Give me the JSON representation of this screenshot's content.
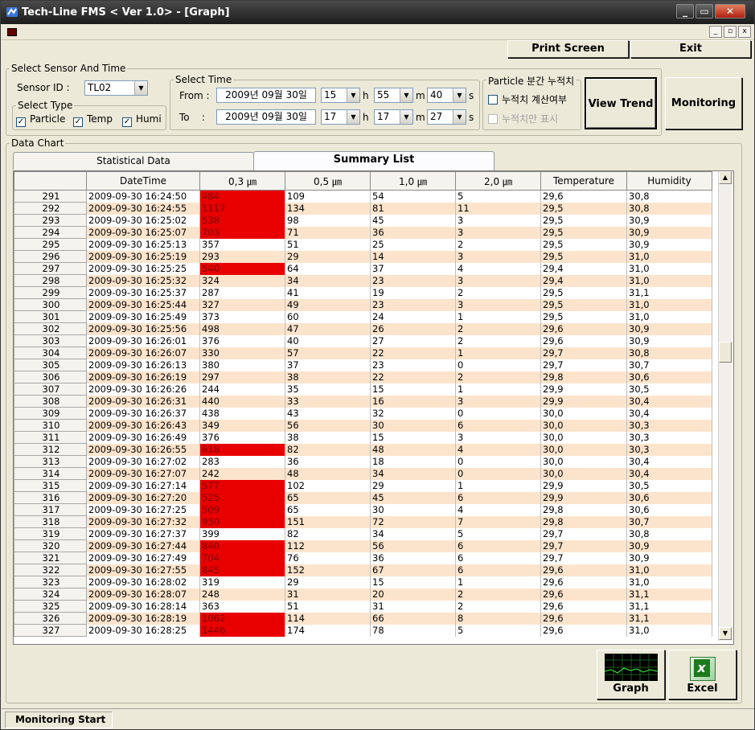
{
  "window": {
    "title": "Tech-Line FMS < Ver 1.0> - [Graph]",
    "min": "_",
    "max": "▭",
    "close": "✕"
  },
  "mdi": {
    "min": "_",
    "restore": "▫",
    "close": "x"
  },
  "toolbar": {
    "print_label": "Print Screen",
    "exit_label": "Exit"
  },
  "sensor_group": {
    "title": "Select Sensor And Time",
    "sensor_id_label": "Sensor ID :",
    "sensor_id_value": "TL02",
    "type_title": "Select Type",
    "types": [
      {
        "label": "Particle",
        "checked": true
      },
      {
        "label": "Temp",
        "checked": true
      },
      {
        "label": "Humi",
        "checked": true
      }
    ],
    "check_mark": "✓"
  },
  "time_group": {
    "title": "Select Time",
    "from_label": "From :",
    "to_label": "To    :",
    "from": {
      "date": "2009년 09월 30일",
      "hour": "15",
      "min": "55",
      "sec": "40"
    },
    "to": {
      "date": "2009년 09월 30일",
      "hour": "17",
      "min": "17",
      "sec": "27"
    },
    "h": "h",
    "m": "m",
    "s": "s",
    "arrow": "▼"
  },
  "particle_group": {
    "title": "Particle 분간 누적치",
    "opt1": "누적치 계산여부",
    "opt2": "누적치만 표시"
  },
  "view_trend_label": "View Trend",
  "monitoring_label": "Monitoring",
  "data_chart": {
    "title": "Data Chart",
    "tabs": [
      "Statistical Data",
      "Summary List"
    ],
    "columns": [
      "",
      "DateTime",
      "0,3 ㎛",
      "0,5 ㎛",
      "1,0 ㎛",
      "2,0 ㎛",
      "Temperature",
      "Humidity"
    ],
    "highlight_color": "#e80000",
    "rows": [
      [
        "291",
        "2009-09-30 16:24:50",
        "484",
        "109",
        "54",
        "5",
        "29,6",
        "30,8",
        1
      ],
      [
        "292",
        "2009-09-30 16:24:55",
        "1117",
        "134",
        "81",
        "11",
        "29,5",
        "30,8",
        1
      ],
      [
        "293",
        "2009-09-30 16:25:02",
        "538",
        "98",
        "45",
        "3",
        "29,5",
        "30,9",
        1
      ],
      [
        "294",
        "2009-09-30 16:25:07",
        "703",
        "71",
        "36",
        "3",
        "29,5",
        "30,9",
        1
      ],
      [
        "295",
        "2009-09-30 16:25:13",
        "357",
        "51",
        "25",
        "2",
        "29,5",
        "30,9",
        0
      ],
      [
        "296",
        "2009-09-30 16:25:19",
        "293",
        "29",
        "14",
        "3",
        "29,5",
        "31,0",
        0
      ],
      [
        "297",
        "2009-09-30 16:25:25",
        "540",
        "64",
        "37",
        "4",
        "29,4",
        "31,0",
        1
      ],
      [
        "298",
        "2009-09-30 16:25:32",
        "324",
        "34",
        "23",
        "3",
        "29,4",
        "31,0",
        0
      ],
      [
        "299",
        "2009-09-30 16:25:37",
        "287",
        "41",
        "19",
        "2",
        "29,5",
        "31,1",
        0
      ],
      [
        "300",
        "2009-09-30 16:25:44",
        "327",
        "49",
        "23",
        "3",
        "29,5",
        "31,0",
        0
      ],
      [
        "301",
        "2009-09-30 16:25:49",
        "373",
        "60",
        "24",
        "1",
        "29,5",
        "31,0",
        0
      ],
      [
        "302",
        "2009-09-30 16:25:56",
        "498",
        "47",
        "26",
        "2",
        "29,6",
        "30,9",
        0
      ],
      [
        "303",
        "2009-09-30 16:26:01",
        "376",
        "40",
        "27",
        "2",
        "29,6",
        "30,9",
        0
      ],
      [
        "304",
        "2009-09-30 16:26:07",
        "330",
        "57",
        "22",
        "1",
        "29,7",
        "30,8",
        0
      ],
      [
        "305",
        "2009-09-30 16:26:13",
        "380",
        "37",
        "23",
        "0",
        "29,7",
        "30,7",
        0
      ],
      [
        "306",
        "2009-09-30 16:26:19",
        "297",
        "38",
        "22",
        "2",
        "29,8",
        "30,6",
        0
      ],
      [
        "307",
        "2009-09-30 16:26:26",
        "244",
        "35",
        "15",
        "1",
        "29,9",
        "30,5",
        0
      ],
      [
        "308",
        "2009-09-30 16:26:31",
        "440",
        "33",
        "16",
        "3",
        "29,9",
        "30,4",
        0
      ],
      [
        "309",
        "2009-09-30 16:26:37",
        "438",
        "43",
        "32",
        "0",
        "30,0",
        "30,4",
        0
      ],
      [
        "310",
        "2009-09-30 16:26:43",
        "349",
        "56",
        "30",
        "6",
        "30,0",
        "30,3",
        0
      ],
      [
        "311",
        "2009-09-30 16:26:49",
        "376",
        "38",
        "15",
        "3",
        "30,0",
        "30,3",
        0
      ],
      [
        "312",
        "2009-09-30 16:26:55",
        "618",
        "82",
        "48",
        "4",
        "30,0",
        "30,3",
        1
      ],
      [
        "313",
        "2009-09-30 16:27:02",
        "283",
        "36",
        "18",
        "0",
        "30,0",
        "30,4",
        0
      ],
      [
        "314",
        "2009-09-30 16:27:07",
        "242",
        "48",
        "34",
        "0",
        "30,0",
        "30,4",
        0
      ],
      [
        "315",
        "2009-09-30 16:27:14",
        "577",
        "102",
        "29",
        "1",
        "29,9",
        "30,5",
        1
      ],
      [
        "316",
        "2009-09-30 16:27:20",
        "525",
        "65",
        "45",
        "6",
        "29,9",
        "30,6",
        1
      ],
      [
        "317",
        "2009-09-30 16:27:25",
        "509",
        "65",
        "30",
        "4",
        "29,8",
        "30,6",
        1
      ],
      [
        "318",
        "2009-09-30 16:27:32",
        "950",
        "151",
        "72",
        "7",
        "29,8",
        "30,7",
        1
      ],
      [
        "319",
        "2009-09-30 16:27:37",
        "399",
        "82",
        "34",
        "5",
        "29,7",
        "30,8",
        0
      ],
      [
        "320",
        "2009-09-30 16:27:44",
        "840",
        "112",
        "56",
        "6",
        "29,7",
        "30,9",
        1
      ],
      [
        "321",
        "2009-09-30 16:27:49",
        "704",
        "76",
        "36",
        "6",
        "29,7",
        "30,9",
        1
      ],
      [
        "322",
        "2009-09-30 16:27:55",
        "845",
        "152",
        "67",
        "6",
        "29,6",
        "31,0",
        1
      ],
      [
        "323",
        "2009-09-30 16:28:02",
        "319",
        "29",
        "15",
        "1",
        "29,6",
        "31,0",
        0
      ],
      [
        "324",
        "2009-09-30 16:28:07",
        "248",
        "31",
        "20",
        "2",
        "29,6",
        "31,1",
        0
      ],
      [
        "325",
        "2009-09-30 16:28:14",
        "363",
        "51",
        "31",
        "2",
        "29,6",
        "31,1",
        0
      ],
      [
        "326",
        "2009-09-30 16:28:19",
        "1062",
        "114",
        "66",
        "8",
        "29,6",
        "31,1",
        1
      ],
      [
        "327",
        "2009-09-30 16:28:25",
        "1446",
        "174",
        "78",
        "5",
        "29,6",
        "31,0",
        1
      ]
    ]
  },
  "graph_label": "Graph",
  "excel_label": "Excel",
  "excel_glyph": "x",
  "scroll_up": "▲",
  "scroll_down": "▼",
  "status": {
    "text": "Monitoring Start"
  }
}
